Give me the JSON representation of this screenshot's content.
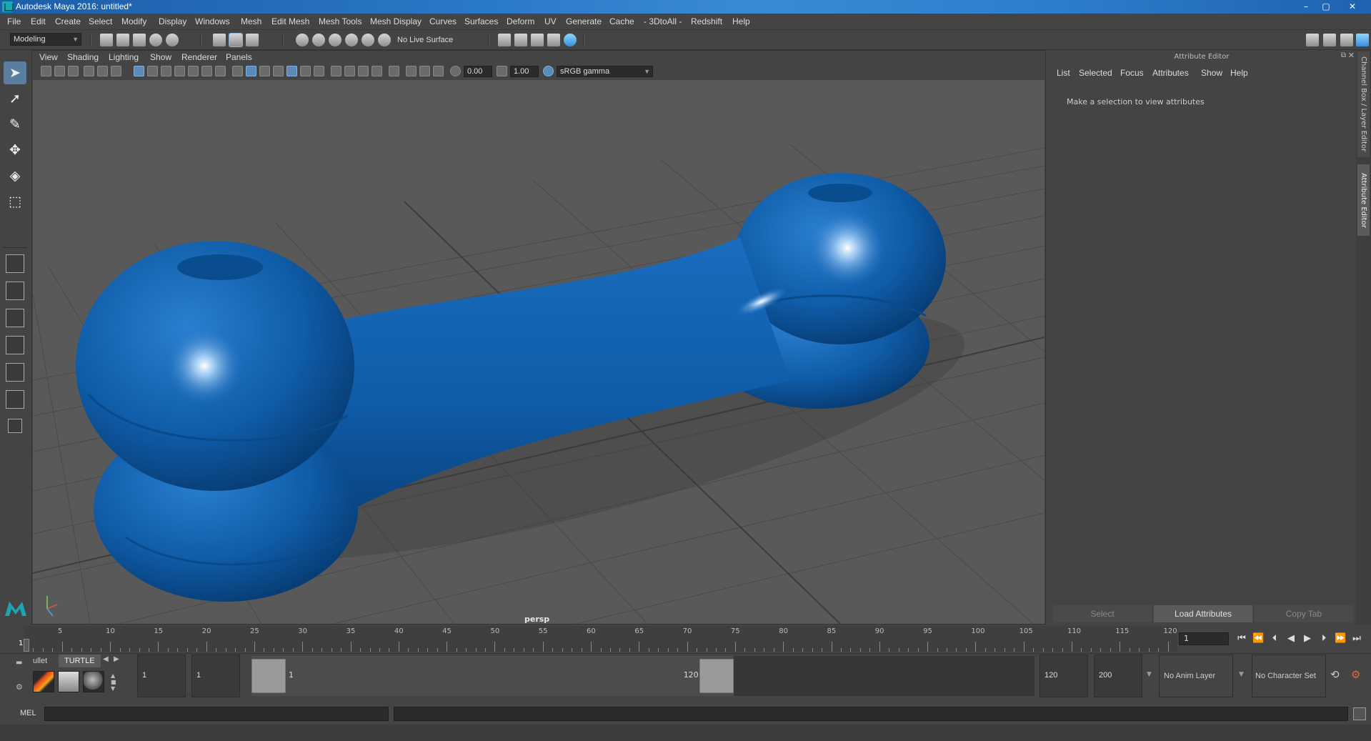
{
  "window": {
    "title": "Autodesk Maya 2016: untitled*",
    "min_label": "–",
    "max_label": "▢",
    "close_label": "✕"
  },
  "menubar": {
    "items": [
      "File",
      "Edit",
      "Create",
      "Select",
      "Modify",
      "Display",
      "Windows",
      "Mesh",
      "Edit Mesh",
      "Mesh Tools",
      "Mesh Display",
      "Curves",
      "Surfaces",
      "Deform",
      "UV",
      "Generate",
      "Cache",
      "- 3DtoAll -",
      "Redshift",
      "Help"
    ]
  },
  "statusline": {
    "mode": "Modeling",
    "live_surface": "No Live Surface"
  },
  "panel_menu": {
    "items": [
      "View",
      "Shading",
      "Lighting",
      "Show",
      "Renderer",
      "Panels"
    ]
  },
  "panel_toolbar": {
    "exposure": "0.00",
    "gamma": "1.00",
    "color_space": "sRGB gamma"
  },
  "viewport": {
    "camera_label": "persp",
    "model_color": "#0f5ca8",
    "grid_color": "#4a4a4a",
    "background_color": "#595959"
  },
  "attribute_editor": {
    "title": "Attribute Editor",
    "menu": [
      "List",
      "Selected",
      "Focus",
      "Attributes",
      "Show",
      "Help"
    ],
    "message": "Make a selection to view attributes",
    "buttons": {
      "select": "Select",
      "load": "Load Attributes",
      "copy": "Copy Tab"
    }
  },
  "side_tabs": {
    "channel_box": "Channel Box / Layer Editor",
    "attribute_editor": "Attribute Editor"
  },
  "time_slider": {
    "ticks": [
      "5",
      "10",
      "15",
      "20",
      "25",
      "30",
      "35",
      "40",
      "45",
      "50",
      "55",
      "60",
      "65",
      "70",
      "75",
      "80",
      "85",
      "90",
      "95",
      "100",
      "105",
      "110",
      "115",
      "120"
    ],
    "current_frame_label": "1",
    "current_frame": "1"
  },
  "range_slider": {
    "shelf_tabs": [
      "ullet",
      "TURTLE"
    ],
    "start_time": "1",
    "playback_start": "1",
    "range_start_label": "1",
    "range_end_label": "120",
    "playback_end": "120",
    "end_time": "200",
    "anim_layer": "No Anim Layer",
    "character_set": "No Character Set"
  },
  "command_line": {
    "label": "MEL"
  }
}
